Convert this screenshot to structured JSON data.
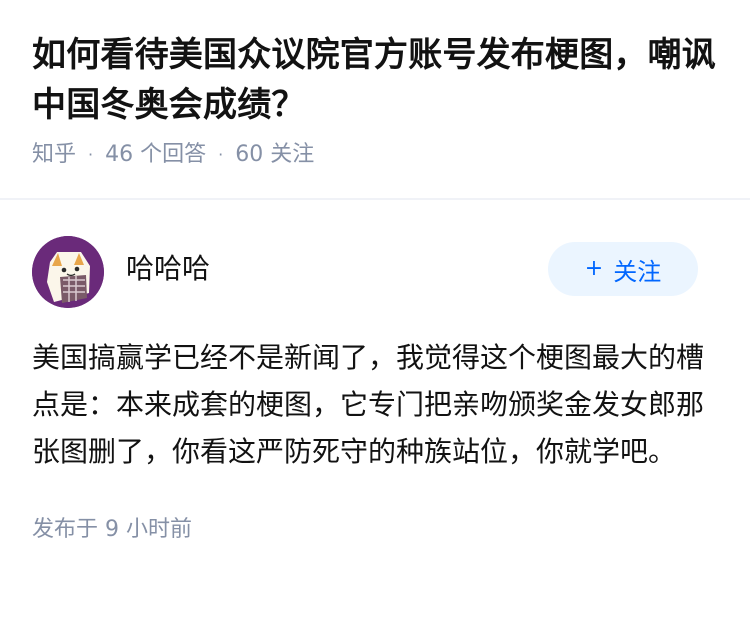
{
  "question": {
    "title": "如何看待美国众议院官方账号发布梗图，嘲讽中国冬奥会成绩？",
    "source": "知乎",
    "answers": "46 个回答",
    "followers": "60 关注"
  },
  "answer": {
    "author_name": "哈哈哈",
    "follow_label": "关注",
    "follow_icon": "plus-icon",
    "content": "美国搞赢学已经不是新闻了，我觉得这个梗图最大的槽点是：本来成套的梗图，它专门把亲吻颁奖金发女郎那张图删了，你看这严防死守的种族站位，你就学吧。",
    "published": "发布于 9 小时前"
  },
  "colors": {
    "accent": "#0066ff",
    "follow_bg": "#ebf5ff",
    "meta_text": "#8590a6",
    "avatar_bg": "#6a2a7a"
  }
}
